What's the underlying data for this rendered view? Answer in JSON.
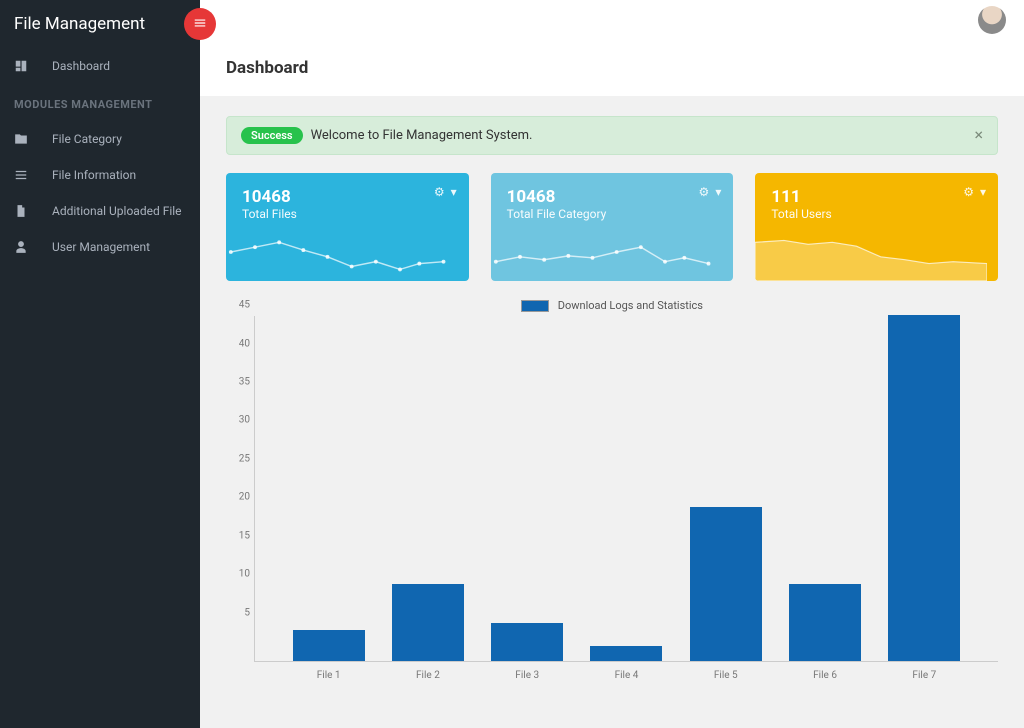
{
  "app_title": "File Management",
  "page_title": "Dashboard",
  "sidebar": {
    "items": [
      {
        "label": "Dashboard",
        "icon": "dashboard-icon"
      }
    ],
    "section_label": "MODULES MANAGEMENT",
    "module_items": [
      {
        "label": "File Category",
        "icon": "folder-icon"
      },
      {
        "label": "File Information",
        "icon": "list-icon"
      },
      {
        "label": "Additional Uploaded File",
        "icon": "file-icon"
      },
      {
        "label": "User Management",
        "icon": "user-icon"
      }
    ]
  },
  "alert": {
    "badge": "Success",
    "text": "Welcome to File Management System."
  },
  "stat_cards": [
    {
      "value": "10468",
      "label": "Total Files",
      "color": "blue"
    },
    {
      "value": "10468",
      "label": "Total File Category",
      "color": "lblue"
    },
    {
      "value": "111",
      "label": "Total Users",
      "color": "yellow"
    }
  ],
  "chart_data": {
    "type": "bar",
    "title": "Download Logs and Statistics",
    "categories": [
      "File 1",
      "File 2",
      "File 3",
      "File 4",
      "File 5",
      "File 6",
      "File 7"
    ],
    "values": [
      4,
      10,
      5,
      2,
      20,
      10,
      45
    ],
    "ylim": [
      0,
      45
    ],
    "yticks": [
      5,
      10,
      15,
      20,
      25,
      30,
      35,
      40,
      45
    ],
    "xlabel": "",
    "ylabel": ""
  }
}
